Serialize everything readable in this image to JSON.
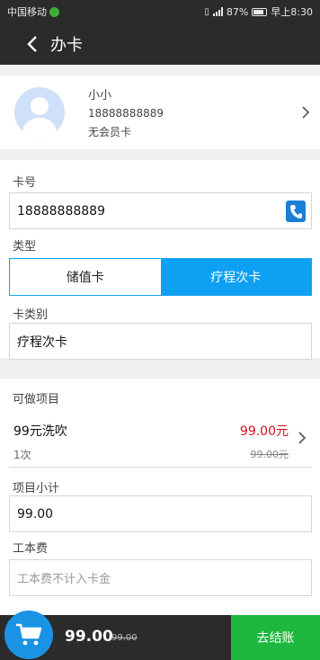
{
  "status_bar": {
    "carrier": "中国移动",
    "battery": "87%",
    "time": "早上8:30"
  },
  "nav": {
    "title": "办卡"
  },
  "member": {
    "name": "小小",
    "phone": "18888888889",
    "level": "无会员卡"
  },
  "card_no": {
    "label": "卡号",
    "value": "18888888889"
  },
  "type": {
    "label": "类型",
    "options": [
      "储值卡",
      "疗程次卡"
    ],
    "selected": "疗程次卡"
  },
  "category": {
    "label": "卡类别",
    "value": "疗程次卡"
  },
  "projects": {
    "label": "可做项目",
    "items": [
      {
        "name": "99元洗吹",
        "count": "1次",
        "price": "99.00元",
        "original_price": "99.00元"
      }
    ]
  },
  "subtotal": {
    "label": "项目小计",
    "value": "99.00"
  },
  "labor_fee": {
    "label": "工本费",
    "placeholder": "工本费不计入卡金"
  },
  "footer": {
    "total": "99.00",
    "original_total": "99.00",
    "checkout_label": "去结账"
  },
  "colors": {
    "accent": "#0ea0f2",
    "checkout": "#1fb83f",
    "price": "#d0101c",
    "header": "#2b2b2b"
  }
}
